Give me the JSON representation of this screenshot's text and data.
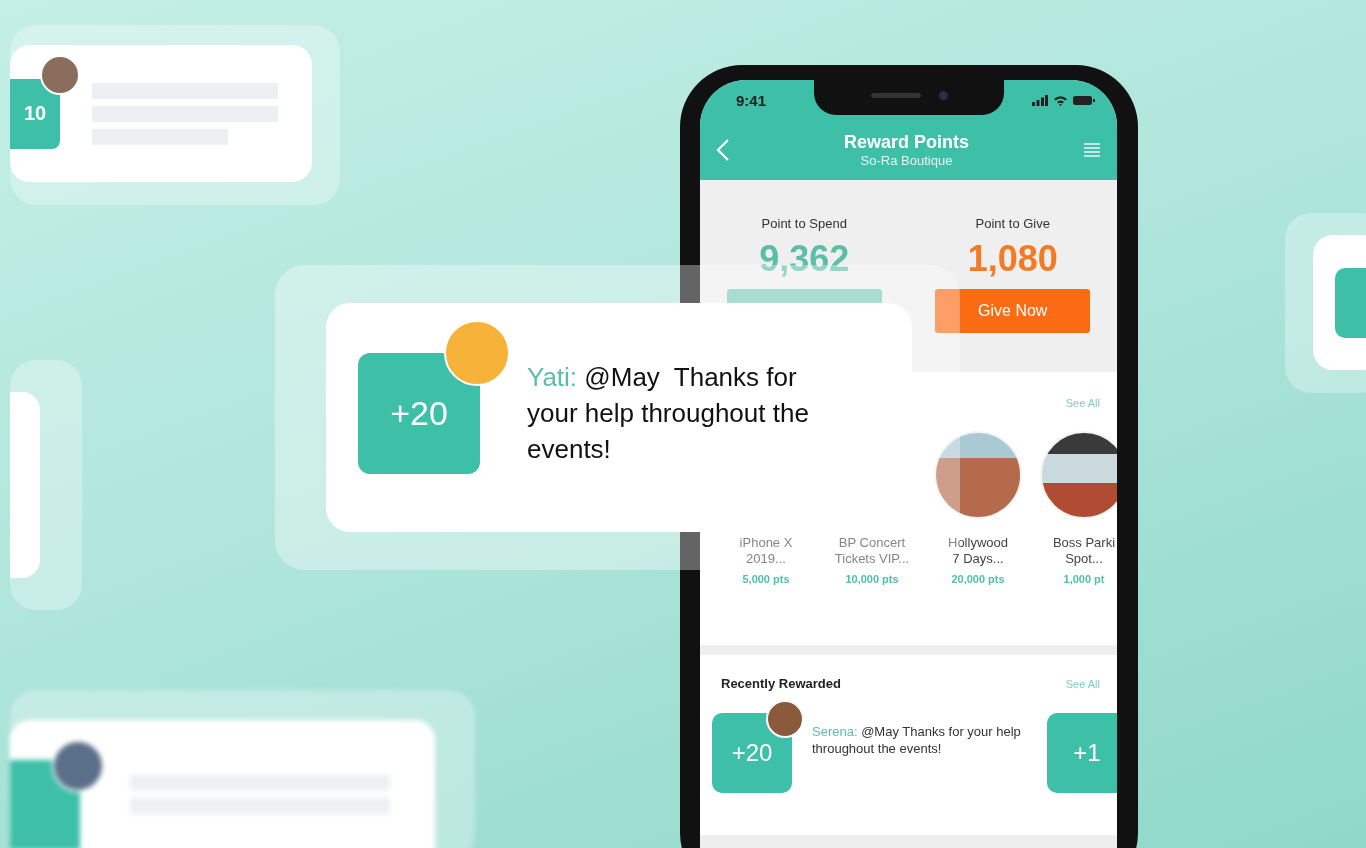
{
  "background_card": {
    "points": "10"
  },
  "status_bar": {
    "time": "9:41"
  },
  "header": {
    "title": "Reward Points",
    "subtitle": "So-Ra Boutique"
  },
  "points": [
    {
      "kind": "spend",
      "label": "Point to Spend",
      "value": "9,362"
    },
    {
      "kind": "give",
      "label": "Point to Give",
      "value": "1,080",
      "button": "Give Now"
    }
  ],
  "rewards": {
    "see_all": "See All",
    "items": [
      {
        "name": "iPhone X\n2019...",
        "price": "5,000 pts",
        "photo": false
      },
      {
        "name": "BP Concert\nTickets VIP...",
        "price": "10,000 pts",
        "photo": false
      },
      {
        "name": "Hollywood\n7 Days...",
        "price": "20,000 pts",
        "photo": true
      },
      {
        "name": "Boss Parki\nSpot...",
        "price": "1,000 pt",
        "photo": true
      }
    ]
  },
  "recent": {
    "title": "Recently Rewarded",
    "see_all": "See All",
    "items": [
      {
        "points": "+20",
        "author": "Serena:",
        "message": "@May Thanks for your help throughout the events!"
      },
      {
        "points": "+1"
      }
    ]
  },
  "notification": {
    "points": "+20",
    "author": "Yati:",
    "message": "@May  Thanks for your help throughout the events!"
  }
}
